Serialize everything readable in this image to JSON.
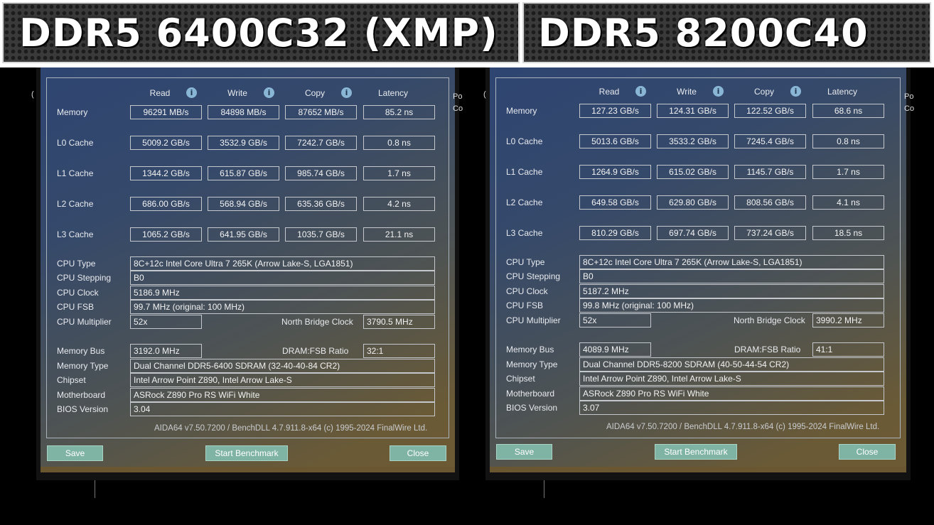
{
  "titles": {
    "left": "DDR5 6400C32 (XMP)",
    "right": "DDR5 8200C40"
  },
  "stray": {
    "left_char": "(",
    "right_line1": "Po",
    "right_line2": "Co"
  },
  "columns": {
    "read": "Read",
    "write": "Write",
    "copy": "Copy",
    "latency": "Latency"
  },
  "row_labels": {
    "memory": "Memory",
    "l0": "L0 Cache",
    "l1": "L1 Cache",
    "l2": "L2 Cache",
    "l3": "L3 Cache",
    "cpu_type": "CPU Type",
    "cpu_stepping": "CPU Stepping",
    "cpu_clock": "CPU Clock",
    "cpu_fsb": "CPU FSB",
    "cpu_multiplier": "CPU Multiplier",
    "nb_clock": "North Bridge Clock",
    "memory_bus": "Memory Bus",
    "dram_fsb": "DRAM:FSB Ratio",
    "memory_type": "Memory Type",
    "chipset": "Chipset",
    "motherboard": "Motherboard",
    "bios_version": "BIOS Version"
  },
  "buttons": {
    "save": "Save",
    "start": "Start Benchmark",
    "close": "Close"
  },
  "footer": "AIDA64 v7.50.7200 / BenchDLL 4.7.911.8-x64  (c) 1995-2024 FinalWire Ltd.",
  "left": {
    "memory": [
      "96291 MB/s",
      "84898 MB/s",
      "87652 MB/s",
      "85.2 ns"
    ],
    "l0": [
      "5009.2 GB/s",
      "3532.9 GB/s",
      "7242.7 GB/s",
      "0.8 ns"
    ],
    "l1": [
      "1344.2 GB/s",
      "615.87 GB/s",
      "985.74 GB/s",
      "1.7 ns"
    ],
    "l2": [
      "686.00 GB/s",
      "568.94 GB/s",
      "635.36 GB/s",
      "4.2 ns"
    ],
    "l3": [
      "1065.2 GB/s",
      "641.95 GB/s",
      "1035.7 GB/s",
      "21.1 ns"
    ],
    "cpu_type": "8C+12c Intel Core Ultra 7 265K  (Arrow Lake-S, LGA1851)",
    "cpu_stepping": "B0",
    "cpu_clock": "5186.9 MHz",
    "cpu_fsb": "99.7 MHz  (original: 100 MHz)",
    "cpu_multiplier": "52x",
    "nb_clock": "3790.5 MHz",
    "memory_bus": "3192.0 MHz",
    "dram_fsb": "32:1",
    "memory_type": "Dual Channel DDR5-6400 SDRAM  (32-40-40-84 CR2)",
    "chipset": "Intel Arrow Point Z890, Intel Arrow Lake-S",
    "motherboard": "ASRock Z890 Pro RS WiFi White",
    "bios_version": "3.04"
  },
  "right": {
    "memory": [
      "127.23 GB/s",
      "124.31 GB/s",
      "122.52 GB/s",
      "68.6 ns"
    ],
    "l0": [
      "5013.6 GB/s",
      "3533.2 GB/s",
      "7245.4 GB/s",
      "0.8 ns"
    ],
    "l1": [
      "1264.9 GB/s",
      "615.02 GB/s",
      "1145.7 GB/s",
      "1.7 ns"
    ],
    "l2": [
      "649.58 GB/s",
      "629.80 GB/s",
      "808.56 GB/s",
      "4.1 ns"
    ],
    "l3": [
      "810.29 GB/s",
      "697.74 GB/s",
      "737.24 GB/s",
      "18.5 ns"
    ],
    "cpu_type": "8C+12c Intel Core Ultra 7 265K  (Arrow Lake-S, LGA1851)",
    "cpu_stepping": "B0",
    "cpu_clock": "5187.2 MHz",
    "cpu_fsb": "99.8 MHz  (original: 100 MHz)",
    "cpu_multiplier": "52x",
    "nb_clock": "3990.2 MHz",
    "memory_bus": "4089.9 MHz",
    "dram_fsb": "41:1",
    "memory_type": "Dual Channel DDR5-8200 SDRAM  (40-50-44-54 CR2)",
    "chipset": "Intel Arrow Point Z890, Intel Arrow Lake-S",
    "motherboard": "ASRock Z890 Pro RS WiFi White",
    "bios_version": "3.07"
  }
}
